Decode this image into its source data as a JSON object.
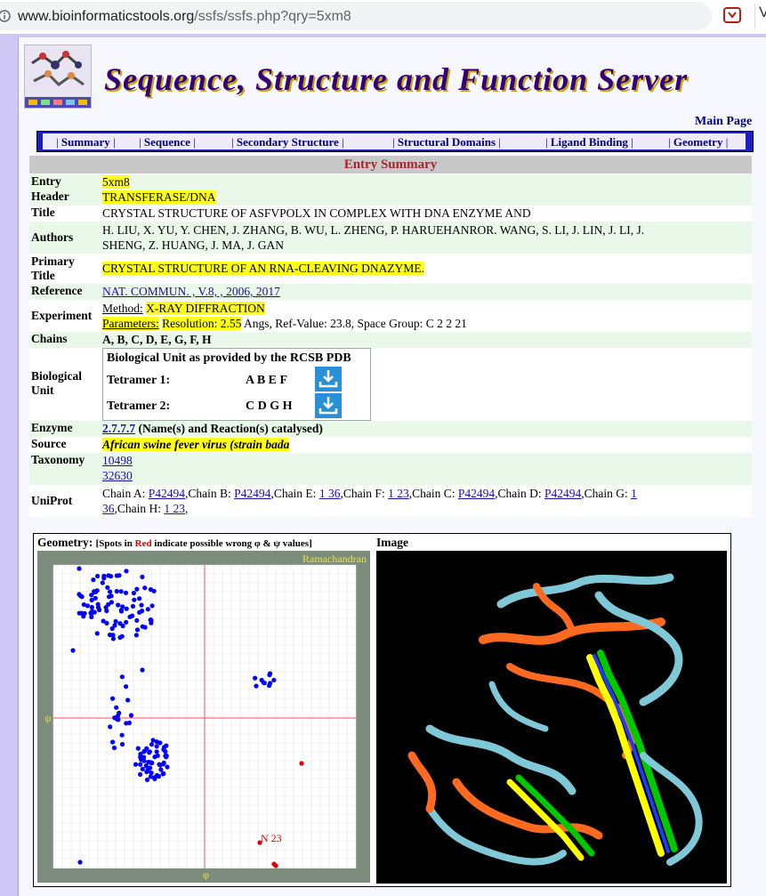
{
  "browser": {
    "url_host": "www.bioinformaticstools.org",
    "url_path": "/ssfs/ssfs.php?qry=5xm8"
  },
  "site": {
    "title": "Sequence, Structure and Function Server",
    "main_page": "Main Page"
  },
  "nav": {
    "items": [
      "Summary",
      "Sequence",
      "Secondary Structure",
      "Structural Domains",
      "Ligand Binding",
      "Geometry"
    ]
  },
  "summary": {
    "heading": "Entry Summary",
    "entry_label": "Entry",
    "entry": "5xm8",
    "header_label": "Header",
    "header": "TRANSFERASE/DNA",
    "title_label": "Title",
    "title": "CRYSTAL STRUCTURE OF ASFVPOLX IN COMPLEX WITH DNA ENZYME AND",
    "authors_label": "Authors",
    "authors_line1": "H. LIU, X. YU, Y. CHEN, J. ZHANG, B. WU, L. ZHENG, P. HARUEHANROR. WANG, S. LI, J. LIN, J. LI, J.",
    "authors_line2": "SHENG, Z. HUANG, J. MA, J. GAN",
    "primary_label_1": "Primary",
    "primary_label_2": "Title",
    "primary_title": "CRYSTAL STRUCTURE OF AN RNA-CLEAVING DNAZYME.",
    "reference_label": "Reference",
    "reference": "NAT. COMMUN. , V.8, , 2006, 2017",
    "experiment_label": "Experiment",
    "method_label": "Method:",
    "method": "X-RAY DIFFRACTION",
    "params_label": "Parameters:",
    "resolution": "Resolution: 2.55",
    "params_rest": "Angs, Ref-Value: 23.8, Space Group: C 2 2 21",
    "chains_label": "Chains",
    "chains": "A, B, C, D, E, G, F, H",
    "bio_label_1": "Biological",
    "bio_label_2": "Unit",
    "bio_heading": "Biological Unit as provided by the RCSB PDB",
    "tetramer1_label": "Tetramer 1:",
    "tetramer1_chains": "A B E F",
    "tetramer2_label": "Tetramer 2:",
    "tetramer2_chains": "C D G H",
    "enzyme_label": "Enzyme",
    "enzyme_ec": "2.7.7.7",
    "enzyme_note": "(Name(s) and Reaction(s) catalysed)",
    "source_label": "Source",
    "source": "African swine fever virus (strain bada",
    "taxonomy_label": "Taxonomy",
    "taxonomy_1": "10498",
    "taxonomy_2": "32630",
    "uniprot_label": "UniProt",
    "uniprot_text_1": "Chain A: ",
    "uniprot_link_1": "P42494",
    "uniprot_text_2": ",Chain B: ",
    "uniprot_link_2": "P42494",
    "uniprot_text_3": ",Chain E: ",
    "uniprot_link_3": "1 36",
    "uniprot_text_4": ",Chain F: ",
    "uniprot_link_4": "1 23",
    "uniprot_text_5": ",Chain C: ",
    "uniprot_link_5": "P42494",
    "uniprot_text_6": ",Chain D: ",
    "uniprot_link_6": "P42494",
    "uniprot_text_7": ",Chain G: ",
    "uniprot_link_7": "1",
    "uniprot_link_7b": "36",
    "uniprot_text_8": ",Chain H: ",
    "uniprot_link_8": "1 23",
    "uniprot_text_9": ","
  },
  "geometry": {
    "label": "Geometry:",
    "note_pre": "[Spots in ",
    "note_red": "Red",
    "note_post": " indicate possible wrong φ & ψ values]",
    "image_label": "Image",
    "plot_title": "Ramachandran",
    "psi": "ψ",
    "phi": "φ",
    "annotation": "N 23",
    "colors": {
      "spot": "#0000ff",
      "wrong_spot": "#e00000",
      "frame": "#7c8c7c"
    }
  }
}
